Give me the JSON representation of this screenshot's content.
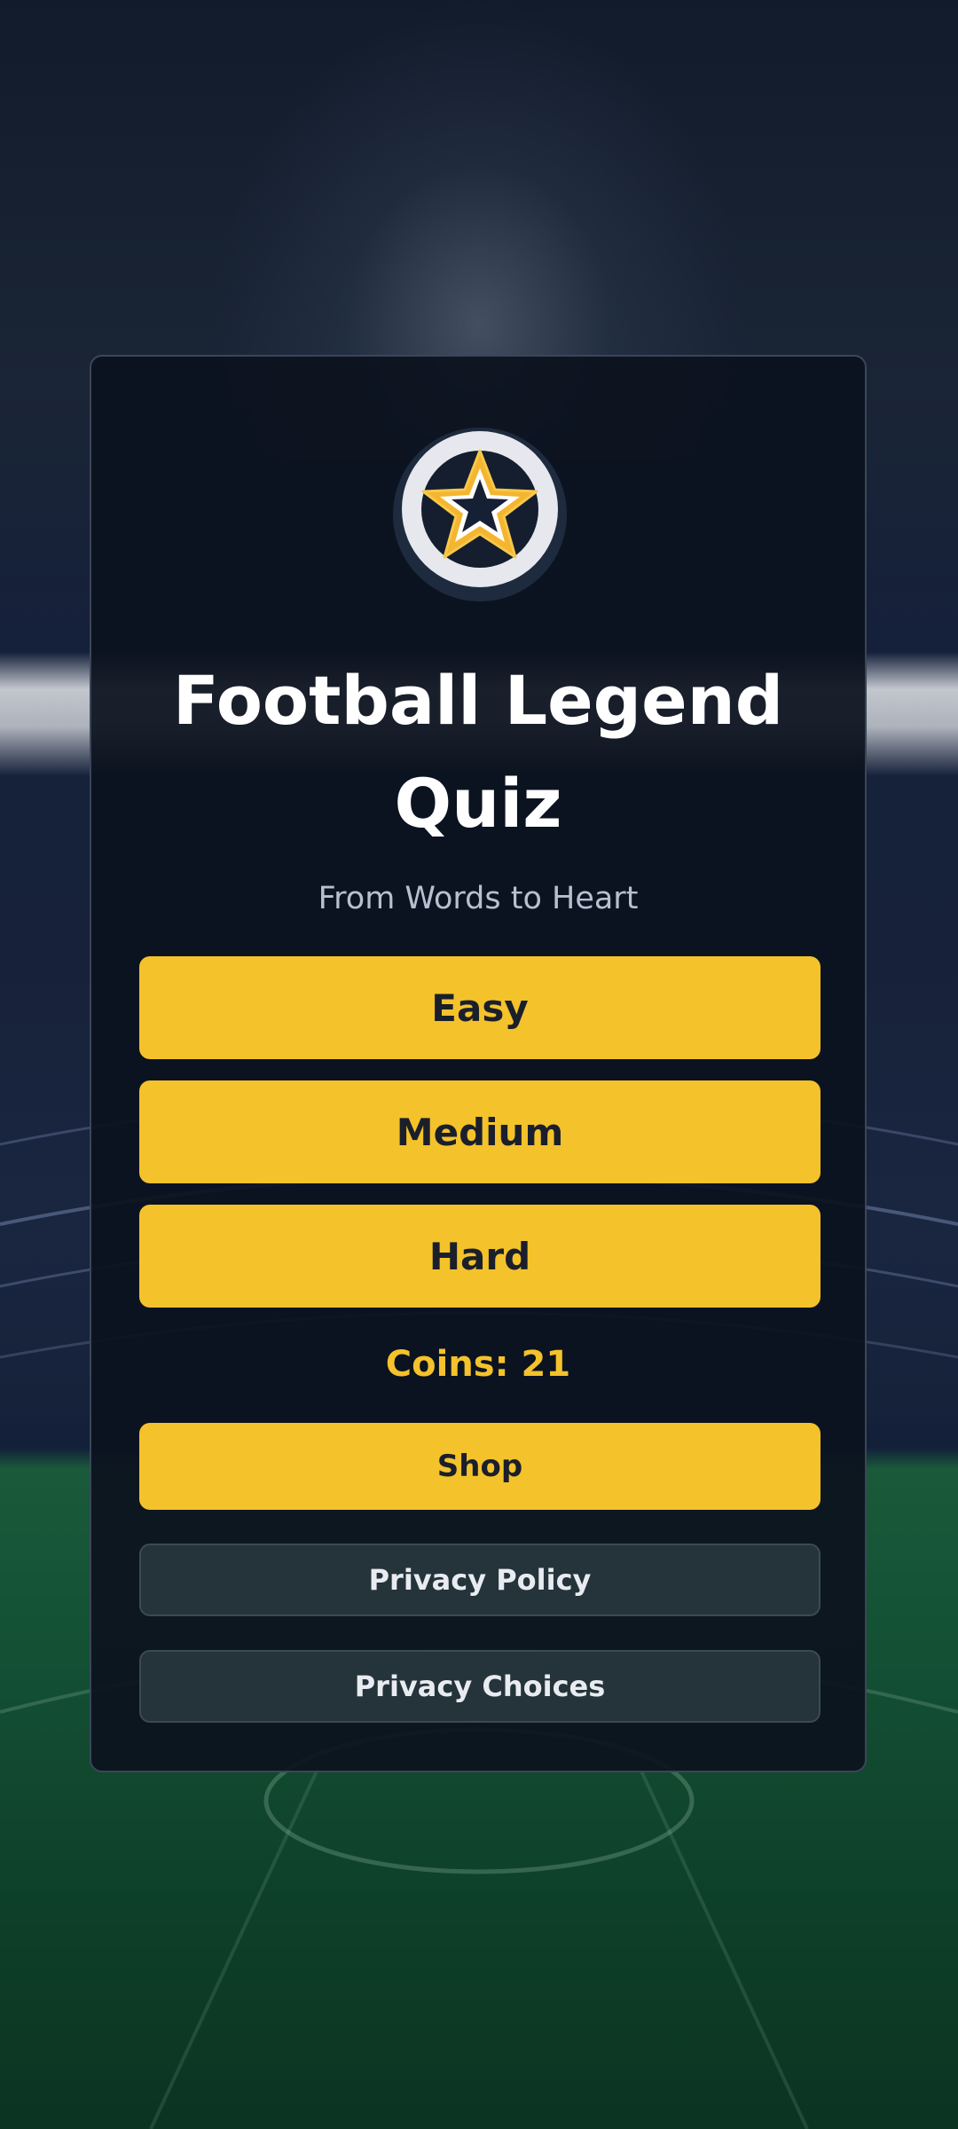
{
  "app": {
    "title_line1": "Football Legend",
    "title_line2": "Quiz",
    "subtitle": "From Words to Heart"
  },
  "icons": {
    "logo": "star-badge-icon"
  },
  "levels": {
    "easy": "Easy",
    "medium": "Medium",
    "hard": "Hard"
  },
  "wallet": {
    "coins_label": "Coins: 21",
    "coins_value": 21
  },
  "actions": {
    "shop": "Shop",
    "privacy_policy": "Privacy Policy",
    "privacy_choices": "Privacy Choices"
  },
  "colors": {
    "accent": "#f4c22b",
    "card_bg": "#0c121e",
    "secondary_button": "#25333b",
    "pitch": "#135034"
  }
}
